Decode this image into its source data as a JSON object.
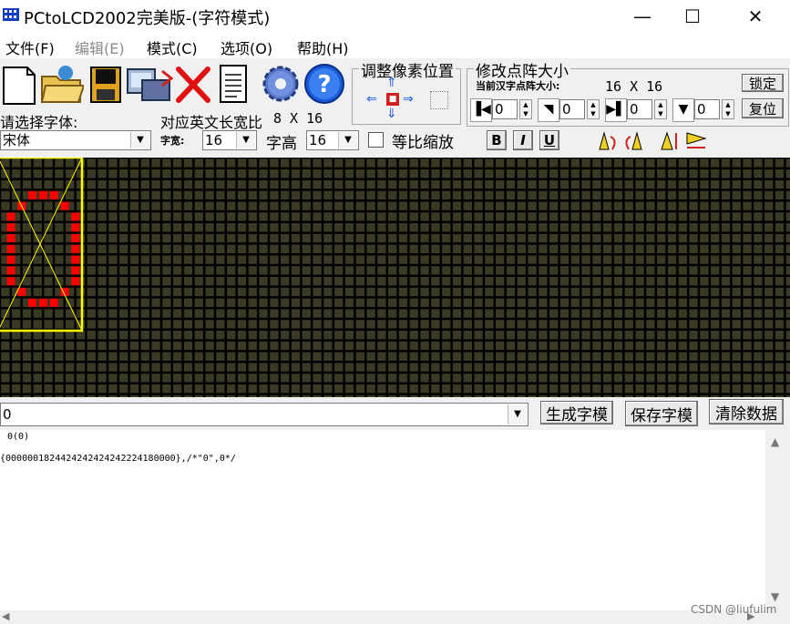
{
  "window": {
    "title": "PCtoLCD2002完美版-(字符模式)",
    "controls": [
      "—",
      "☐",
      "✕"
    ]
  },
  "menu": [
    {
      "label": "文件(F)",
      "enabled": true
    },
    {
      "label": "编辑(E)",
      "enabled": false
    },
    {
      "label": "模式(C)",
      "enabled": true
    },
    {
      "label": "选项(O)",
      "enabled": true
    },
    {
      "label": "帮助(H)",
      "enabled": true
    }
  ],
  "toolbar": {
    "icons": [
      "new-file-icon",
      "open-folder-icon",
      "save-disk-icon",
      "import-image-icon",
      "delete-x-icon",
      "notepad-icon",
      "settings-gear-icon",
      "help-question-icon"
    ]
  },
  "font_panel": {
    "select_font_label": "请选择字体:",
    "font_value": "宋体",
    "ratio_label": "对应英文长宽比",
    "ratio_value": "8 X 16",
    "width_label": "字宽:",
    "width_value": "16",
    "height_label": "字高",
    "height_value": "16",
    "proportional_label": "等比缩放",
    "bold": "B",
    "italic": "I",
    "underline": "U"
  },
  "pixel_adjust": {
    "title": "调整像素位置"
  },
  "matrix_size": {
    "title": "修改点阵大小",
    "current_label": "当前汉字点阵大小:",
    "current_value": "16 X 16",
    "lock_button": "锁定",
    "reset_button": "复位",
    "spin_values": [
      "0",
      "0",
      "0",
      "0"
    ]
  },
  "bottom": {
    "input_value": "0",
    "generate_button": "生成字模",
    "save_button": "保存字模",
    "clear_button": "清除数据",
    "output_line1": " 0(0)",
    "output_line2": "{0000001824424242424242224180000},/*\"0\",0*/",
    "watermark": "CSDN @liufulim"
  },
  "colors": {
    "grid_bg": "#3a3a24",
    "pixel_on": "#ff0000",
    "highlight_frame": "#ffff00"
  }
}
